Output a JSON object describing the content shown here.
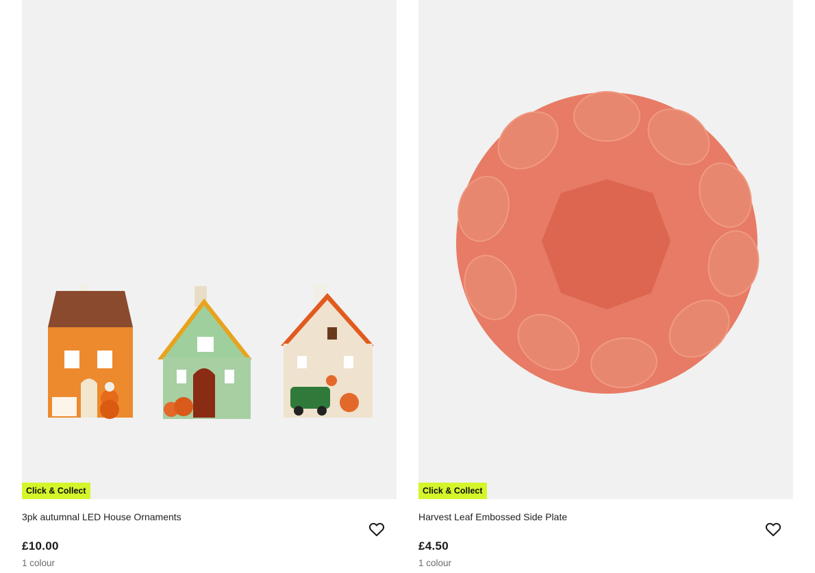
{
  "products": [
    {
      "image_alt": "3pk autumnal LED House Ornaments",
      "badge": "Click & Collect",
      "title": "3pk autumnal LED House Ornaments",
      "price": "£10.00",
      "colours": "1 colour",
      "wishlist_icon": "heart-outline-icon"
    },
    {
      "image_alt": "Harvest Leaf Embossed Side Plate",
      "badge": "Click & Collect",
      "title": "Harvest Leaf Embossed Side Plate",
      "price": "£4.50",
      "colours": "1 colour",
      "wishlist_icon": "heart-outline-icon"
    }
  ],
  "colors": {
    "badge_bg": "#d4f52a",
    "image_bg": "#f1f1f1",
    "plate": "#e07560"
  }
}
